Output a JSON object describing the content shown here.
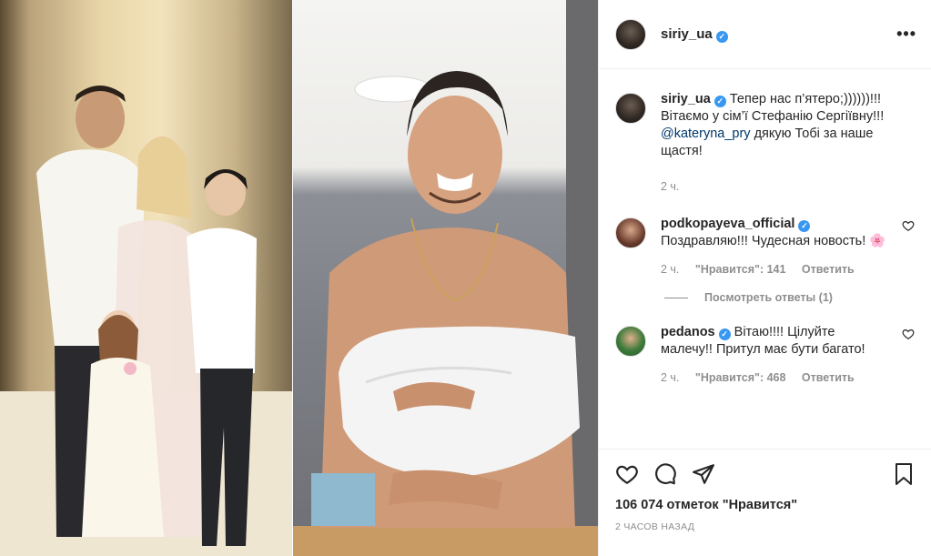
{
  "post": {
    "username": "siriy_ua",
    "more_icon": "ellipsis-icon",
    "caption_line1": "Тепер нас п’ятеро;))))))!!! Вітаємо у сім’ї Стефанію Сергіївну!!!",
    "mention": "@kateryna_pry",
    "caption_line2": "дякую Тобі за наше щастя!",
    "caption_time": "2 ч."
  },
  "comments": [
    {
      "username": "podkopayeva_official",
      "text": "Поздравляю!!! Чудесная новость! 🌸",
      "time": "2 ч.",
      "likes": "\"Нравится\": 141",
      "reply": "Ответить",
      "view_replies": "Посмотреть ответы (1)"
    },
    {
      "username": "pedanos",
      "text": "Вітаю!!!! Цілуйте малечу!! Притул має бути багато!",
      "time": "2 ч.",
      "likes": "\"Нравится\": 468",
      "reply": "Ответить"
    }
  ],
  "footer": {
    "likes_count": "106 074 отметок \"Нравится\"",
    "posted_time": "2 часов назад"
  },
  "colors": {
    "accent": "#3897f0",
    "mention": "#00376b",
    "muted": "#8e8e8e"
  }
}
